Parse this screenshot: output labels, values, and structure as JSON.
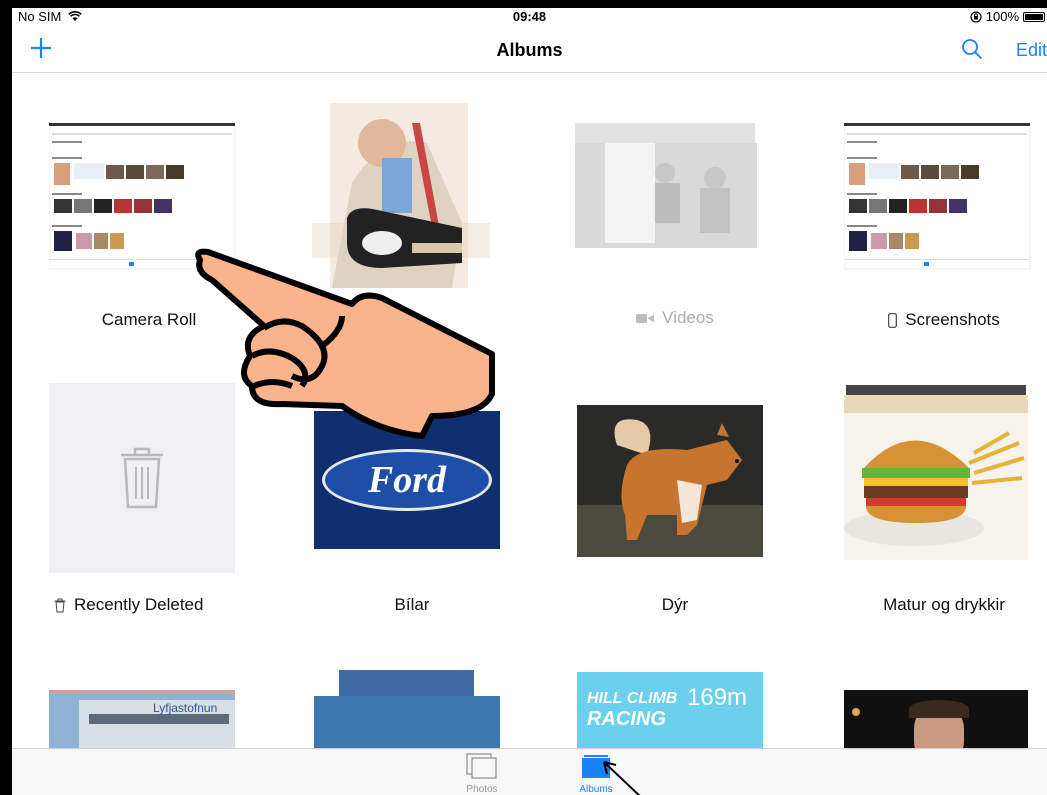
{
  "status": {
    "carrier": "No SIM",
    "time": "09:48",
    "battery": "100%"
  },
  "nav": {
    "title": "Albums",
    "edit_label": "Edit"
  },
  "albums": [
    {
      "name": "Camera Roll"
    },
    {
      "name": "Videos"
    },
    {
      "name": "Screenshots"
    },
    {
      "name": "Recently Deleted"
    },
    {
      "name": "Bílar"
    },
    {
      "name": "Dýr"
    },
    {
      "name": "Matur og drykkir"
    }
  ],
  "thumb_text": {
    "ford": "Ford",
    "building_sign": "Lyfjastofnun",
    "game_title_1": "HILL CLIMB",
    "game_title_2": "RACING",
    "game_distance": "169m"
  },
  "tabs": [
    {
      "label": "Photos"
    },
    {
      "label": "Albums"
    }
  ],
  "colors": {
    "accent": "#1a82fb",
    "hand_fill": "#f9b48b"
  }
}
